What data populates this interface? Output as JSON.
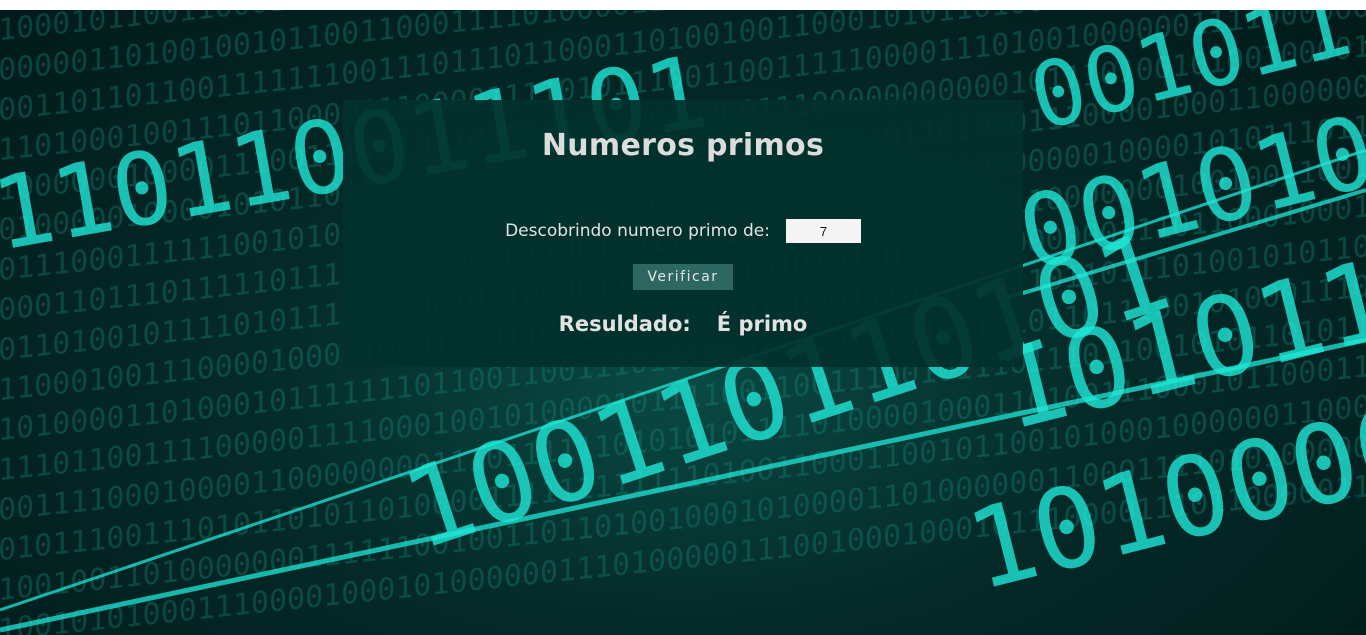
{
  "page": {
    "title": "Numeros primos"
  },
  "form": {
    "label": "Descobrindo numero primo de:",
    "input_value": "7"
  },
  "actions": {
    "verify_label": "Verificar"
  },
  "result": {
    "label": "Resuldado:",
    "value": "É primo"
  },
  "colors": {
    "panel_bg": "#02302c",
    "button_bg": "#2c6761",
    "accent_cyan": "#1fe8d8"
  }
}
